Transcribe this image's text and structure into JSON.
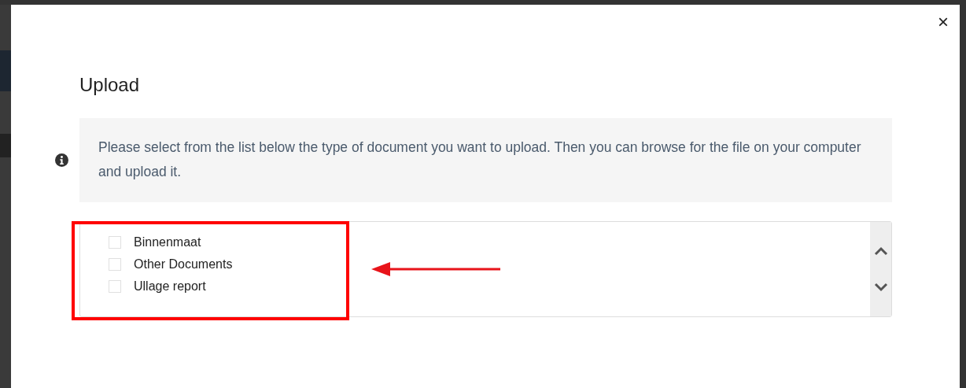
{
  "dialog": {
    "title": "Upload",
    "close": "×"
  },
  "info": {
    "text": "Please select from the list below the type of document you want to upload. Then you can browse for the file on your computer and upload it."
  },
  "document_types": [
    {
      "label": "Binnenmaat",
      "checked": false
    },
    {
      "label": "Other Documents",
      "checked": false
    },
    {
      "label": "Ullage report",
      "checked": false
    }
  ]
}
